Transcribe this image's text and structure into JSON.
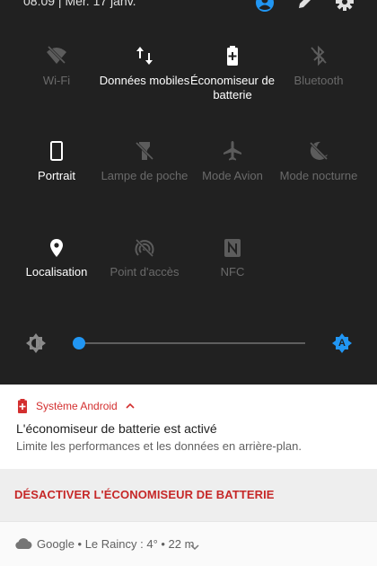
{
  "status_bar": {
    "time_date": "08:09 | Mer. 17 janv.",
    "icons": [
      "account-icon",
      "edit-icon",
      "settings-icon"
    ]
  },
  "tiles": [
    {
      "label": "Wi-Fi",
      "icon": "wifi-off-icon",
      "active": false
    },
    {
      "label": "Données mobiles",
      "icon": "mobile-data-icon",
      "active": true
    },
    {
      "label": "Économiseur de batterie",
      "icon": "battery-saver-icon",
      "active": true
    },
    {
      "label": "Bluetooth",
      "icon": "bluetooth-icon",
      "active": false
    },
    {
      "label": "Portrait",
      "icon": "portrait-icon",
      "active": true
    },
    {
      "label": "Lampe de poche",
      "icon": "flashlight-icon",
      "active": false
    },
    {
      "label": "Mode Avion",
      "icon": "airplane-icon",
      "active": false
    },
    {
      "label": "Mode nocturne",
      "icon": "night-mode-icon",
      "active": false
    },
    {
      "label": "Localisation",
      "icon": "location-icon",
      "active": true
    },
    {
      "label": "Point d'accès",
      "icon": "hotspot-icon",
      "active": false
    },
    {
      "label": "NFC",
      "icon": "nfc-icon",
      "active": false
    }
  ],
  "brightness": {
    "level": 0.0,
    "auto_badge": "A"
  },
  "notification": {
    "app_name": "Système Android",
    "title": "L'économiseur de batterie est activé",
    "text": "Limite les performances et les données en arrière-plan.",
    "action": "DÉSACTIVER L'ÉCONOMISEUR DE BATTERIE"
  },
  "weather": {
    "text": "Google • Le Raincy : 4° • 22 m"
  },
  "colors": {
    "panel_bg": "#212121",
    "accent": "#2196f3",
    "notif_red": "#d32f2f",
    "inactive": "#6a6a6a"
  }
}
